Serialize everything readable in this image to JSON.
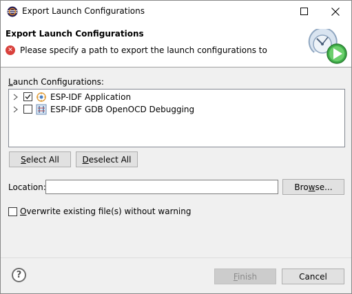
{
  "window": {
    "title": "Export Launch Configurations",
    "maximize_glyph": "☐",
    "close_glyph": "✕"
  },
  "banner": {
    "title": "Export Launch Configurations",
    "message": "Please specify a path to export the launch configurations to",
    "error_glyph": "✕"
  },
  "configs": {
    "label": "Launch Configurations:",
    "items": [
      {
        "label": "ESP-IDF Application",
        "checked": true,
        "icon": "esp-idf-app-icon"
      },
      {
        "label": "ESP-IDF GDB OpenOCD Debugging",
        "checked": false,
        "icon": "gdb-debug-icon"
      }
    ]
  },
  "buttons": {
    "select_all": "Select All",
    "deselect_all": "Deselect All",
    "browse": "Browse...",
    "finish": "Finish",
    "cancel": "Cancel"
  },
  "location": {
    "label": "Location:",
    "value": "",
    "placeholder": ""
  },
  "overwrite": {
    "label": "Overwrite existing file(s) without warning",
    "checked": false
  },
  "help": {
    "glyph": "?"
  }
}
